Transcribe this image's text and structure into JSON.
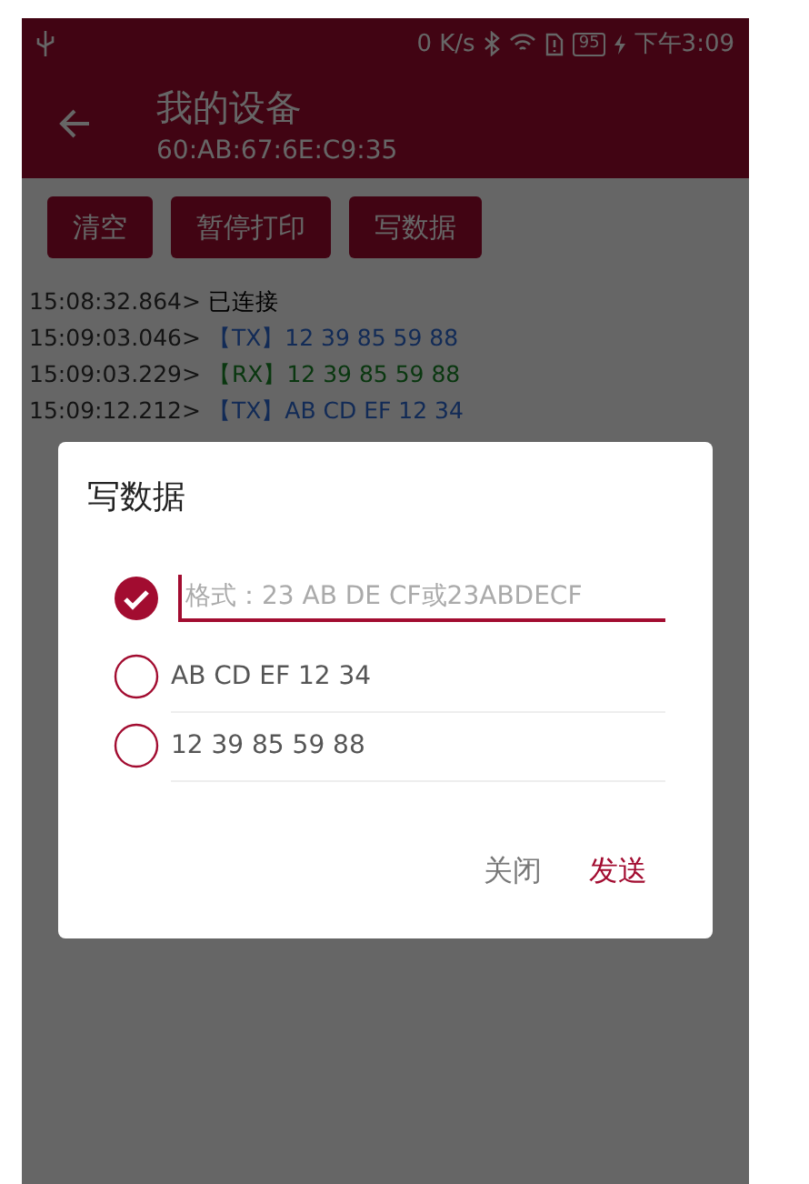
{
  "status_bar": {
    "network_speed": "0 K/s",
    "battery": "95",
    "time": "下午3:09"
  },
  "app_bar": {
    "title": "我的设备",
    "subtitle": "60:AB:67:6E:C9:35"
  },
  "toolbar_buttons": [
    "清空",
    "暂停打印",
    "写数据"
  ],
  "log": [
    {
      "time": "15:08:32.864>",
      "kind": "status",
      "text": "已连接"
    },
    {
      "time": "15:09:03.046>",
      "kind": "tx",
      "tag": "【TX】",
      "text": "12 39 85 59 88"
    },
    {
      "time": "15:09:03.229>",
      "kind": "rx",
      "tag": "【RX】",
      "text": "12 39 85 59 88"
    },
    {
      "time": "15:09:12.212>",
      "kind": "tx",
      "tag": "【TX】",
      "text": "AB CD EF 12 34"
    }
  ],
  "dialog": {
    "title": "写数据",
    "options": [
      {
        "kind": "input",
        "placeholder": "格式：23 AB DE CF或23ABDECF",
        "selected": true
      },
      {
        "kind": "preset",
        "text": "AB CD EF 12 34",
        "selected": false
      },
      {
        "kind": "preset",
        "text": "12 39 85 59 88",
        "selected": false
      }
    ],
    "buttons": [
      {
        "label": "关闭",
        "kind": "secondary"
      },
      {
        "label": "发送",
        "kind": "primary"
      }
    ]
  }
}
